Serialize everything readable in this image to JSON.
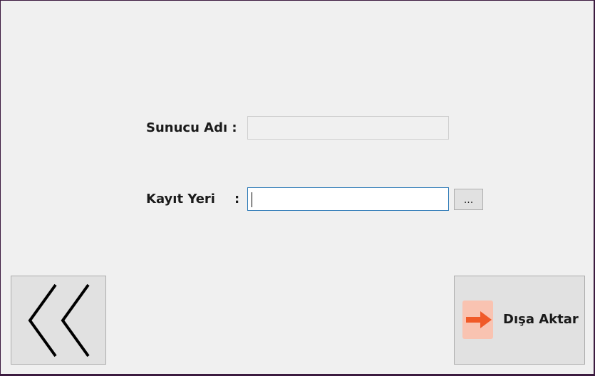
{
  "form": {
    "server_name_label": "Sunucu Adı :",
    "server_name_value": "",
    "save_location_label": "Kayıt Yeri",
    "save_location_colon": ":",
    "save_location_value": "",
    "browse_label": "..."
  },
  "buttons": {
    "back_icon": "double-chevron-left-icon",
    "export_icon": "arrow-right-icon",
    "export_label": "Dışa Aktar"
  },
  "colors": {
    "window_background": "#f0f0f0",
    "frame": "#3b1a3f",
    "active_field_border": "#2b79b6",
    "export_icon_background": "#f9c3b1",
    "export_arrow": "#f05a28"
  }
}
